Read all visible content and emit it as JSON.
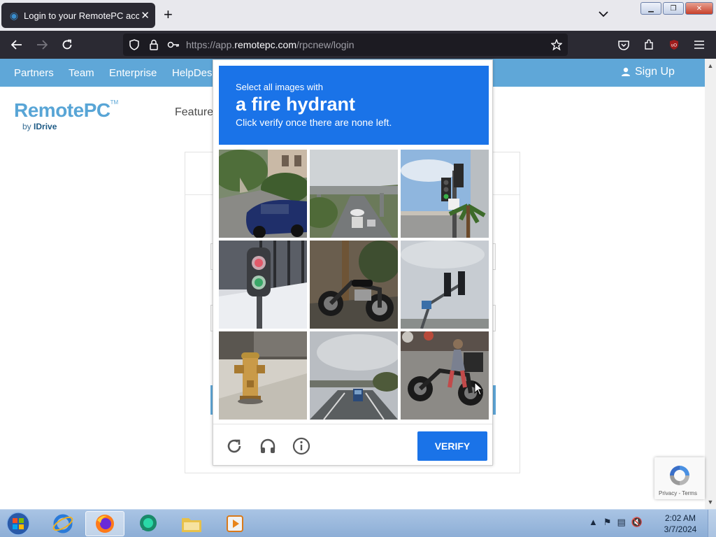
{
  "browser": {
    "tab_title": "Login to your RemotePC accou",
    "tab_close": "✕",
    "new_tab": "+",
    "url_prefix": "https://app.",
    "url_host": "remotepc.com",
    "url_path": "/rpcnew/login"
  },
  "site": {
    "nav": [
      "Partners",
      "Team",
      "Enterprise",
      "HelpDes"
    ],
    "signup": "Sign Up",
    "logo_brand": "RemotePC",
    "logo_tm": "TM",
    "logo_by": "by",
    "logo_idrive": "IDrive",
    "features": "Feature"
  },
  "captcha": {
    "instruction_line1": "Select all images with",
    "target": "a fire hydrant",
    "instruction_line3": "Click verify once there are none left.",
    "verify_label": "VERIFY",
    "tiles": [
      "street-corner-blue-car",
      "highway-overpass-traffic",
      "traffic-light-palm-tree",
      "pedestrian-signal",
      "parked-motorcycle",
      "traffic-lights-cloudy-sky",
      "fire-hydrant-sidewalk",
      "highway-truck",
      "motorcycle-rider"
    ]
  },
  "badge": {
    "terms": "Privacy - Terms"
  },
  "taskbar": {
    "time": "2:02 AM",
    "date": "3/7/2024"
  }
}
